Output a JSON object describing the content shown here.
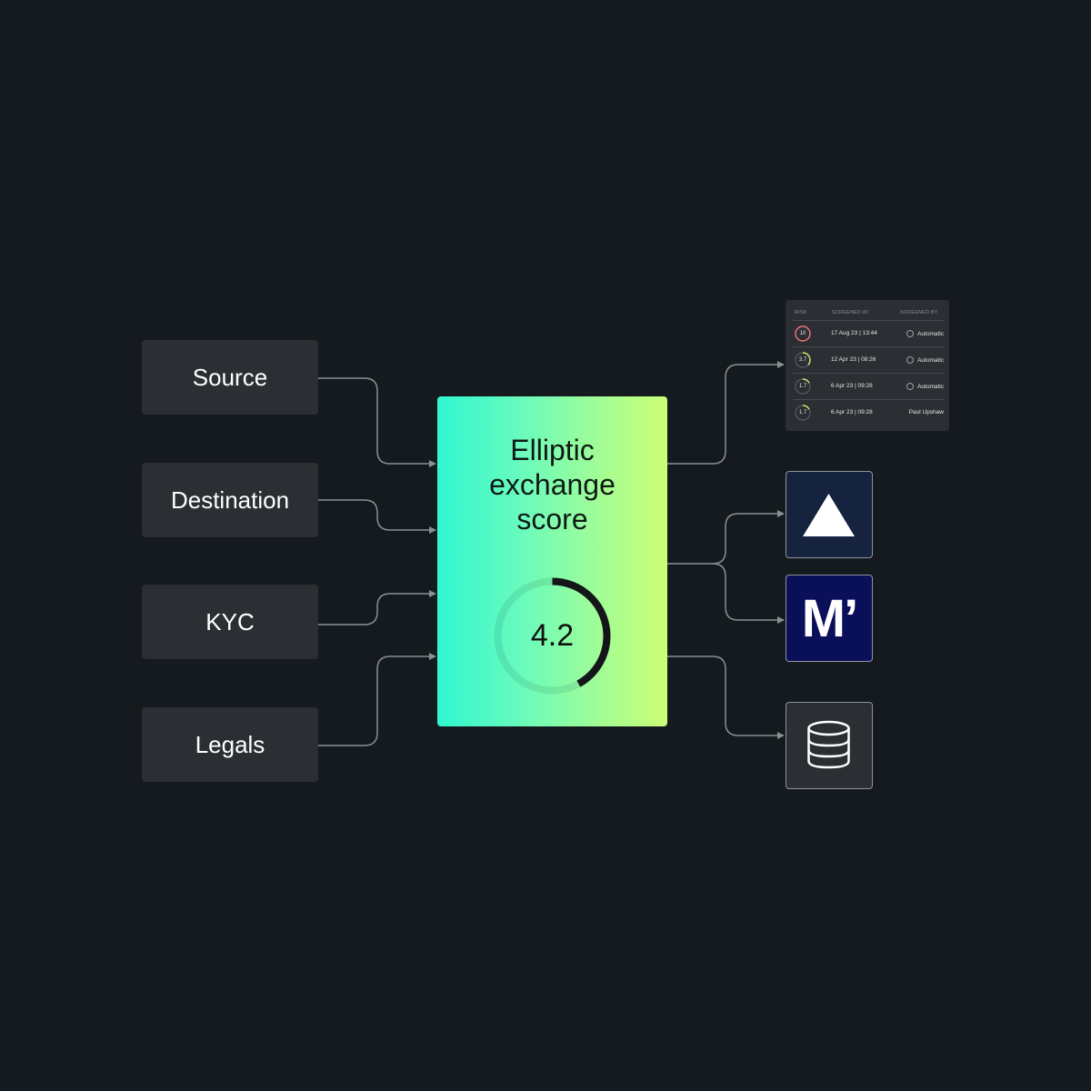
{
  "inputs": [
    {
      "label": "Source"
    },
    {
      "label": "Destination"
    },
    {
      "label": "KYC"
    },
    {
      "label": "Legals"
    }
  ],
  "score_card": {
    "title": "Elliptic\nexchange\nscore",
    "score": "4.2",
    "gauge_fraction": 0.42,
    "gradient": [
      "#2ff7d0",
      "#cbfe77"
    ]
  },
  "risk_table": {
    "headers": [
      "RISK",
      "SCREENED AT",
      "SCREENED BY"
    ],
    "rows": [
      {
        "risk": "10",
        "risk_fraction": 1.0,
        "color": "#f0727a",
        "screened_at": "17 Aug 23 | 13:44",
        "screened_by": "Automatic",
        "auto": true
      },
      {
        "risk": "3.7",
        "risk_fraction": 0.37,
        "color": "#c6ec6a",
        "screened_at": "12 Apr 23 | 08:26",
        "screened_by": "Automatic",
        "auto": true
      },
      {
        "risk": "1.7",
        "risk_fraction": 0.17,
        "color": "#c6ec6a",
        "screened_at": "6 Apr 23 | 09:28",
        "screened_by": "Automatic",
        "auto": true
      },
      {
        "risk": "1.7",
        "risk_fraction": 0.17,
        "color": "#c6ec6a",
        "screened_at": "6 Apr 23 | 09:28",
        "screened_by": "Paul Upshaw",
        "auto": false
      }
    ]
  },
  "outputs": {
    "m_logo": "M’",
    "icons": [
      "triangle-logo-icon",
      "m-logo-icon",
      "database-icon"
    ]
  },
  "colors": {
    "background": "#141a1d",
    "box": "#2b2f34",
    "connector": "#8a8f94"
  }
}
